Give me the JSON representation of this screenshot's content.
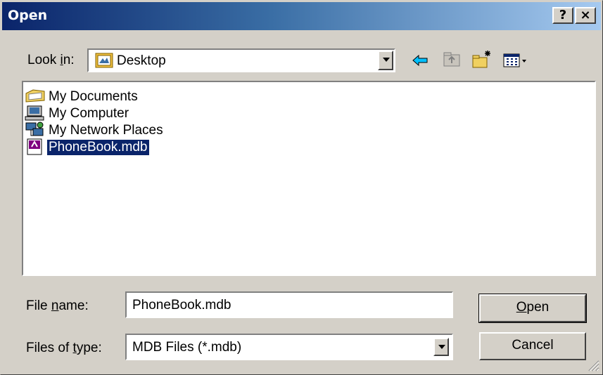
{
  "window": {
    "title": "Open",
    "help_label": "?",
    "close_label": "×"
  },
  "lookin": {
    "label_pre": "Look ",
    "label_key": "i",
    "label_post": "n:",
    "value": "Desktop"
  },
  "toolbar": {
    "icons": [
      "back-arrow-icon",
      "up-folder-icon",
      "new-folder-icon",
      "view-menu-icon"
    ]
  },
  "files": [
    {
      "name": "My Documents",
      "icon": "my-documents-icon"
    },
    {
      "name": "My Computer",
      "icon": "my-computer-icon"
    },
    {
      "name": "My Network Places",
      "icon": "network-places-icon"
    },
    {
      "name": "PhoneBook.mdb",
      "icon": "mdb-file-icon",
      "selected": true
    }
  ],
  "filename": {
    "label_pre": "File ",
    "label_key": "n",
    "label_post": "ame:",
    "value": "PhoneBook.mdb"
  },
  "filetype": {
    "label_pre": "Files of ",
    "label_key": "t",
    "label_post": "ype:",
    "value": "MDB Files (*.mdb)"
  },
  "buttons": {
    "open_key": "O",
    "open_rest": "pen",
    "cancel": "Cancel"
  },
  "colors": {
    "titlebar_start": "#0a246a",
    "titlebar_end": "#a6caf0",
    "selection": "#0a246a",
    "face": "#d4d0c8"
  }
}
